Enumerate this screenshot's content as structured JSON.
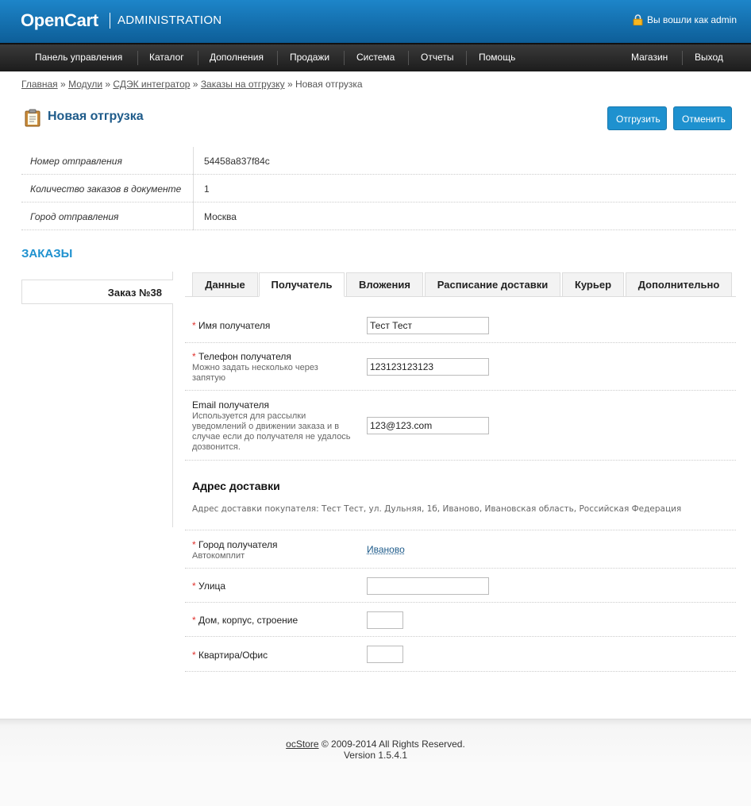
{
  "header": {
    "logo": "OpenCart",
    "subtitle": "ADMINISTRATION",
    "logged_in": "Вы вошли как admin"
  },
  "menu": {
    "items": [
      "Панель управления",
      "Каталог",
      "Дополнения",
      "Продажи",
      "Система",
      "Отчеты",
      "Помощь"
    ],
    "right": [
      "Магазин",
      "Выход"
    ]
  },
  "breadcrumb": {
    "items": [
      "Главная",
      "Модули",
      "СДЭК интегратор",
      "Заказы на отгрузку"
    ],
    "current": "Новая отгрузка",
    "separator": "»"
  },
  "page": {
    "title": "Новая отгрузка",
    "ship_button": "Отгрузить",
    "cancel_button": "Отменить"
  },
  "info": [
    {
      "label": "Номер отправления",
      "value": "54458a837f84c"
    },
    {
      "label": "Количество заказов в документе",
      "value": "1"
    },
    {
      "label": "Город отправления",
      "value": "Москва"
    }
  ],
  "orders": {
    "section_title": "ЗАКАЗЫ",
    "order_tab": "Заказ №38"
  },
  "tabs": [
    "Данные",
    "Получатель",
    "Вложения",
    "Расписание доставки",
    "Курьер",
    "Дополнительно"
  ],
  "form": {
    "name": {
      "required": "*",
      "label": "Имя получателя",
      "value": "Тест Тест"
    },
    "phone": {
      "required": "*",
      "label": "Телефон получателя",
      "help": "Можно задать несколько через запятую",
      "value": "123123123123"
    },
    "email": {
      "label": "Email получателя",
      "help": "Используется для рассылки уведомлений о движении заказа и в случае если до получателя не удалось дозвонится.",
      "value": "123@123.com"
    },
    "address_title": "Адрес доставки",
    "address_line": "Адрес доставки покупателя: Тест Тест, ул. Дульняя, 1б, Иваново, Ивановская область, Российская Федерация",
    "city": {
      "required": "*",
      "label": "Город получателя",
      "help": "Автокомплит",
      "value": "Иваново"
    },
    "street": {
      "required": "*",
      "label": "Улица",
      "value": ""
    },
    "house": {
      "required": "*",
      "label": "Дом, корпус, строение",
      "value": ""
    },
    "flat": {
      "required": "*",
      "label": "Квартира/Офис",
      "value": ""
    }
  },
  "footer": {
    "brand": "ocStore",
    "copyright": "© 2009-2014 All Rights Reserved.",
    "version": "Version 1.5.4.1"
  },
  "colors": {
    "header_blue": "#1d85c9",
    "accent": "#1e91cf",
    "required": "#e0312d"
  }
}
